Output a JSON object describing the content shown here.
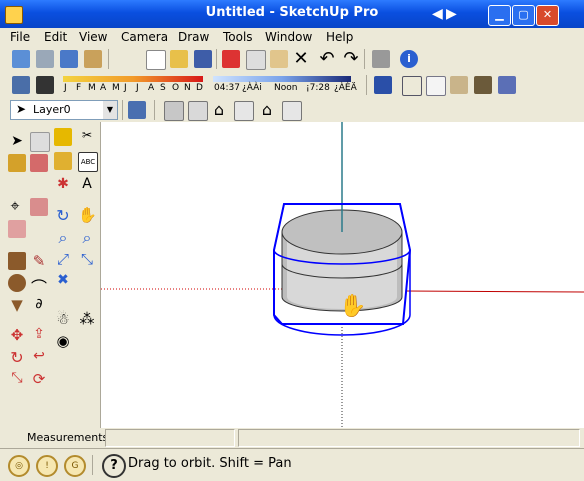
{
  "window": {
    "title": "Untitled - SketchUp Pro"
  },
  "menu": [
    "File",
    "Edit",
    "View",
    "Camera",
    "Draw",
    "Tools",
    "Window",
    "Help"
  ],
  "shadows": {
    "months": [
      "J",
      "F",
      "M",
      "A",
      "M",
      "J",
      "J",
      "A",
      "S",
      "O",
      "N",
      "D"
    ],
    "time_start": "04:37",
    "time_start_suffix": "¿ÀÀi",
    "noon": "Noon",
    "time_end": "¡7:28",
    "time_end_suffix": "¿ÀÈÄ"
  },
  "layer": {
    "selected": "Layer0"
  },
  "measurements": {
    "label": "Measurements"
  },
  "status": {
    "text": "Drag to orbit.  Shift = Pan"
  },
  "colors": {
    "titlebar": "#0a4fe0",
    "axis_red": "#d00000",
    "axis_green": "#008000",
    "axis_blue": "#0000cc",
    "selection_blue": "#0000ff"
  }
}
